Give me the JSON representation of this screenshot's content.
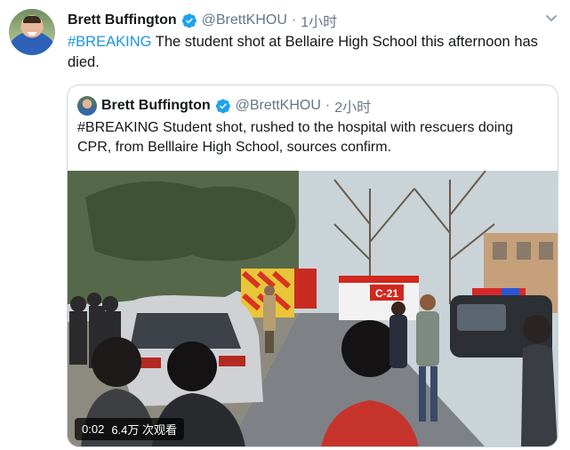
{
  "tweet": {
    "author_name": "Brett Buffington",
    "handle": "@BrettKHOU",
    "separator": "·",
    "time": "1小时",
    "hashtag": "#BREAKING",
    "text": " The student shot at Bellaire High School this afternoon has died."
  },
  "quoted_tweet": {
    "author_name": "Brett Buffington",
    "handle": "@BrettKHOU",
    "separator": "·",
    "time": "2小时",
    "text": "#BREAKING Student shot, rushed to the hospital with rescuers doing CPR, from Belllaire High School, sources confirm."
  },
  "video": {
    "duration": "0:02",
    "views": "6.4万 次观看",
    "scene_signs": {
      "engine_label": "C-21"
    }
  },
  "icons": {
    "verified": "verified-badge-icon",
    "menu": "chevron-down-icon"
  },
  "colors": {
    "hashtag": "#1b95e0",
    "verified": "#1da1f2",
    "secondary_text": "#657786",
    "border": "#ccd6dd"
  }
}
